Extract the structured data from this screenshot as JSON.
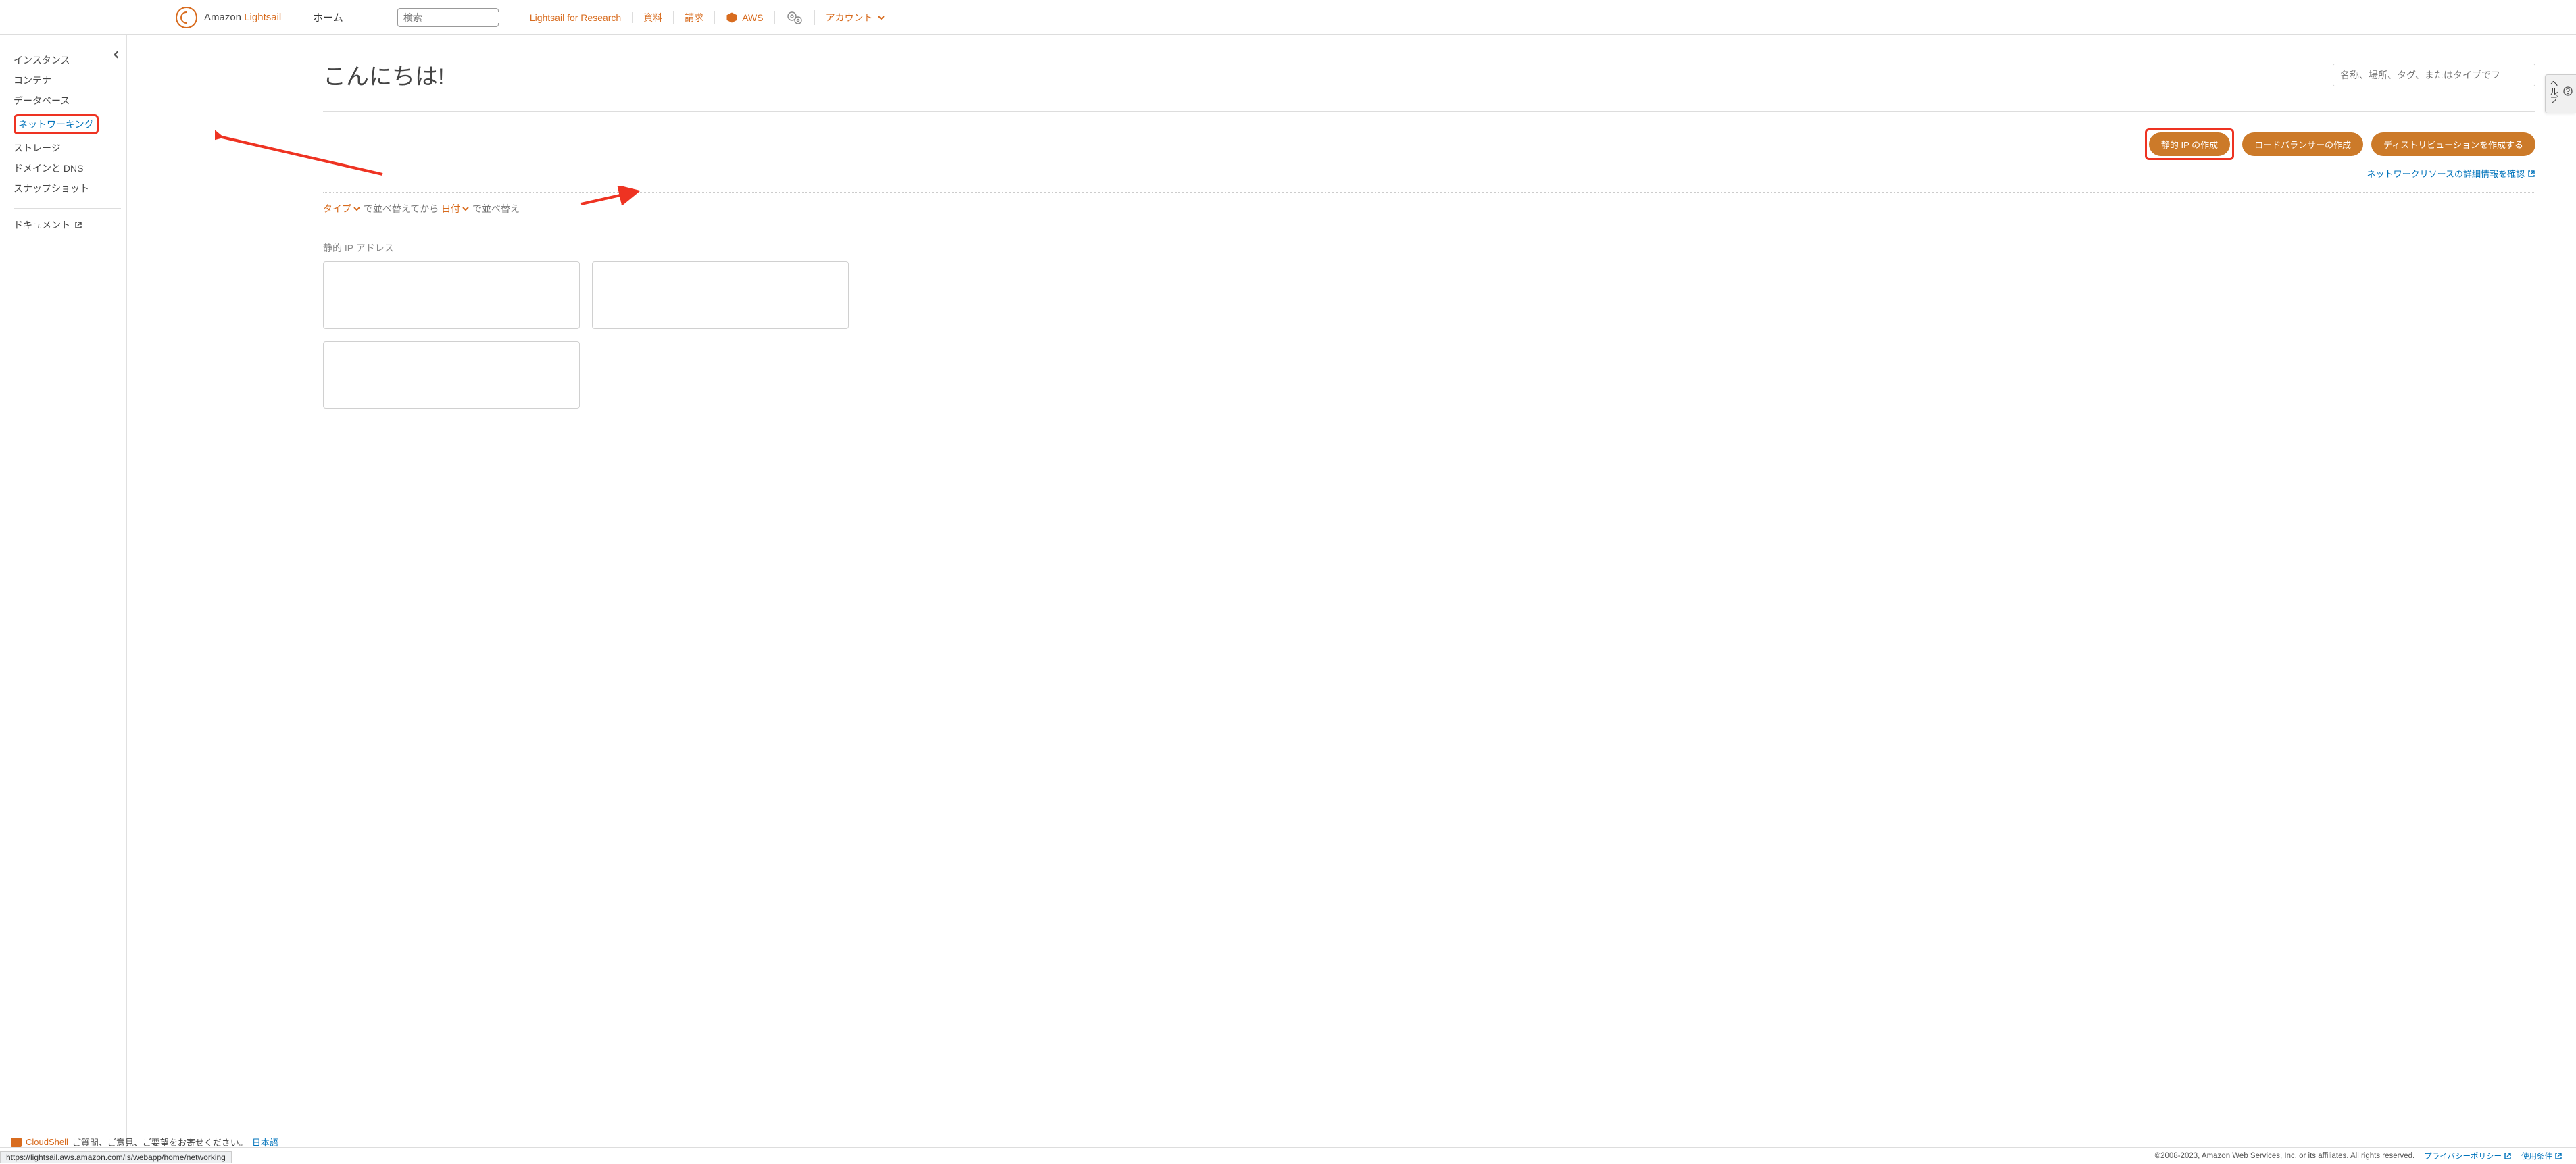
{
  "header": {
    "logo_prefix": "Amazon ",
    "logo_bold": "Lightsail",
    "home": "ホーム",
    "search_placeholder": "検索",
    "links": {
      "research": "Lightsail for Research",
      "docs": "資料",
      "billing": "請求",
      "aws": "AWS",
      "account": "アカウント"
    }
  },
  "help_tab": "ヘルプ",
  "sidebar": {
    "items": [
      "インスタンス",
      "コンテナ",
      "データベース",
      "ネットワーキング",
      "ストレージ",
      "ドメインと DNS",
      "スナップショット"
    ],
    "doc": "ドキュメント"
  },
  "main": {
    "greeting": "こんにちは!",
    "filter_placeholder": "名称、場所、タグ、またはタイプでフ",
    "buttons": {
      "static_ip": "静的 IP の作成",
      "lb": "ロードバランサーの作成",
      "dist": "ディストリビューションを作成する"
    },
    "learn_more": "ネットワークリソースの詳細情報を確認",
    "sort": {
      "type": "タイプ",
      "mid": " で並べ替えてから ",
      "date": "日付",
      "end": " で並べ替え"
    },
    "section_label": "静的 IP アドレス"
  },
  "cloudshell": {
    "label": "CloudShell",
    "suffix_1": "ご質問、ご意見、ご要望をお寄せください。",
    "lang": "日本語"
  },
  "footer": {
    "copyright": "©2008-2023, Amazon Web Services, Inc. or its affiliates. All rights reserved.",
    "privacy": "プライバシーポリシー",
    "terms": "使用条件"
  },
  "status_url": "https://lightsail.aws.amazon.com/ls/webapp/home/networking"
}
